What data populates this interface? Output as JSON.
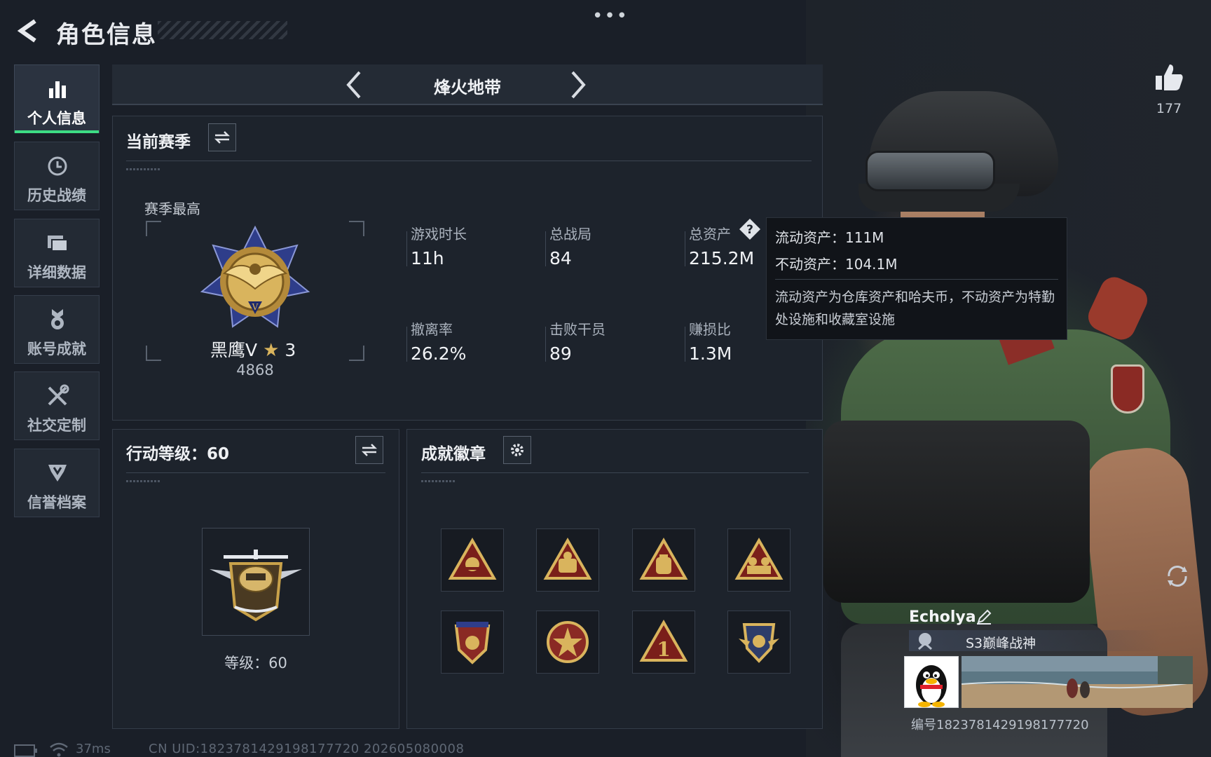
{
  "header": {
    "title": "角色信息"
  },
  "nav": {
    "items": [
      {
        "label": "个人信息",
        "icon": "bar-chart-icon",
        "active": true
      },
      {
        "label": "历史战绩",
        "icon": "history-clock-icon",
        "active": false
      },
      {
        "label": "详细数据",
        "icon": "folder-icon",
        "active": false
      },
      {
        "label": "账号成就",
        "icon": "achievement-medal-icon",
        "active": false
      },
      {
        "label": "社交定制",
        "icon": "tools-icon",
        "active": false
      },
      {
        "label": "信誉档案",
        "icon": "shield-badge-icon",
        "active": false
      }
    ]
  },
  "map_selector": {
    "current": "烽火地带"
  },
  "season": {
    "title": "当前赛季",
    "best_label": "赛季最高",
    "rank_name": "黑鹰V",
    "rank_stars": "3",
    "rank_score": "4868",
    "stats": [
      {
        "label": "游戏时长",
        "value": "11h"
      },
      {
        "label": "总战局",
        "value": "84"
      },
      {
        "label": "总资产",
        "value": "215.2M"
      },
      {
        "label": "撤离率",
        "value": "26.2%"
      },
      {
        "label": "击败干员",
        "value": "89"
      },
      {
        "label": "赚损比",
        "value": "1.3M"
      }
    ]
  },
  "tooltip": {
    "liquid": "流动资产：111M",
    "fixed": "不动资产：104.1M",
    "description": "流动资产为仓库资产和哈夫币，不动资产为特勤处设施和收藏室设施"
  },
  "action_level": {
    "title": "行动等级：60",
    "caption": "等级：60"
  },
  "achievements": {
    "title": "成就徽章",
    "badges": [
      "badge-triangle-helmet",
      "badge-triangle-soldier",
      "badge-triangle-bag",
      "badge-triangle-squad",
      "badge-shield-stars",
      "badge-round-star",
      "badge-triangle-one",
      "badge-shield-wings"
    ]
  },
  "likes": {
    "count": "177"
  },
  "player": {
    "name": "Echolya",
    "title": "S3巅峰战神",
    "id_text": "编号1823781429198177720"
  },
  "status": {
    "ping": "37ms",
    "uid": "CN UID:1823781429198177720 202605080008"
  },
  "colors": {
    "accent": "#3ddc84",
    "panel": "#1d232c",
    "gold": "#c9a24a"
  }
}
